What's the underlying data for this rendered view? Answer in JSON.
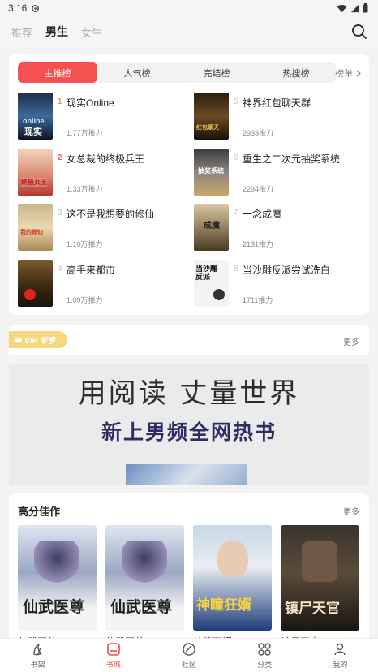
{
  "status_bar": {
    "time": "3:16"
  },
  "top_tabs": [
    {
      "label": "推荐",
      "active": false
    },
    {
      "label": "男生",
      "active": true
    },
    {
      "label": "女生",
      "active": false
    }
  ],
  "ranking": {
    "tabs": [
      "主推榜",
      "人气榜",
      "完结榜",
      "热搜榜"
    ],
    "more_label": "榜单",
    "books": [
      {
        "rank": "1",
        "title": "现实Online",
        "sub": "1.77万推力"
      },
      {
        "rank": "2",
        "title": "女总裁的终极兵王",
        "sub": "1.33万推力"
      },
      {
        "rank": "3",
        "title": "这不是我想要的修仙",
        "sub": "1.10万推力"
      },
      {
        "rank": "4",
        "title": "高手来都市",
        "sub": "1.09万推力"
      },
      {
        "rank": "5",
        "title": "神界红包聊天群",
        "sub": "2933推力"
      },
      {
        "rank": "6",
        "title": "重生之二次元抽奖系统",
        "sub": "2294推力"
      },
      {
        "rank": "7",
        "title": "一念成魔",
        "sub": "2131推力"
      },
      {
        "rank": "8",
        "title": "当沙雕反派尝试洗白",
        "sub": "1711推力"
      }
    ]
  },
  "vip": {
    "badge": "VIP 专享",
    "more": "更多"
  },
  "banner": {
    "line1": "用阅读 丈量世界",
    "line2": "新上男频全网热书"
  },
  "high_score": {
    "title": "高分佳作",
    "more": "更多",
    "books": [
      {
        "name": "仙武医尊",
        "cover_text": "仙武医尊"
      },
      {
        "name": "仙武医尊",
        "cover_text": "仙武医尊"
      },
      {
        "name": "神瞳狂婿",
        "cover_text": "神瞳狂婿"
      },
      {
        "name": "镇尸天官",
        "cover_text": "镇尸天官"
      }
    ]
  },
  "bottom_nav": [
    {
      "label": "书架",
      "icon": "bookshelf-icon",
      "active": false
    },
    {
      "label": "书城",
      "icon": "bookstore-icon",
      "active": true
    },
    {
      "label": "社区",
      "icon": "community-icon",
      "active": false
    },
    {
      "label": "分类",
      "icon": "category-icon",
      "active": false
    },
    {
      "label": "我的",
      "icon": "profile-icon",
      "active": false
    }
  ],
  "colors": {
    "accent": "#f65151",
    "vip_gold": "#f7d77e",
    "banner_text": "#2c2e63"
  }
}
